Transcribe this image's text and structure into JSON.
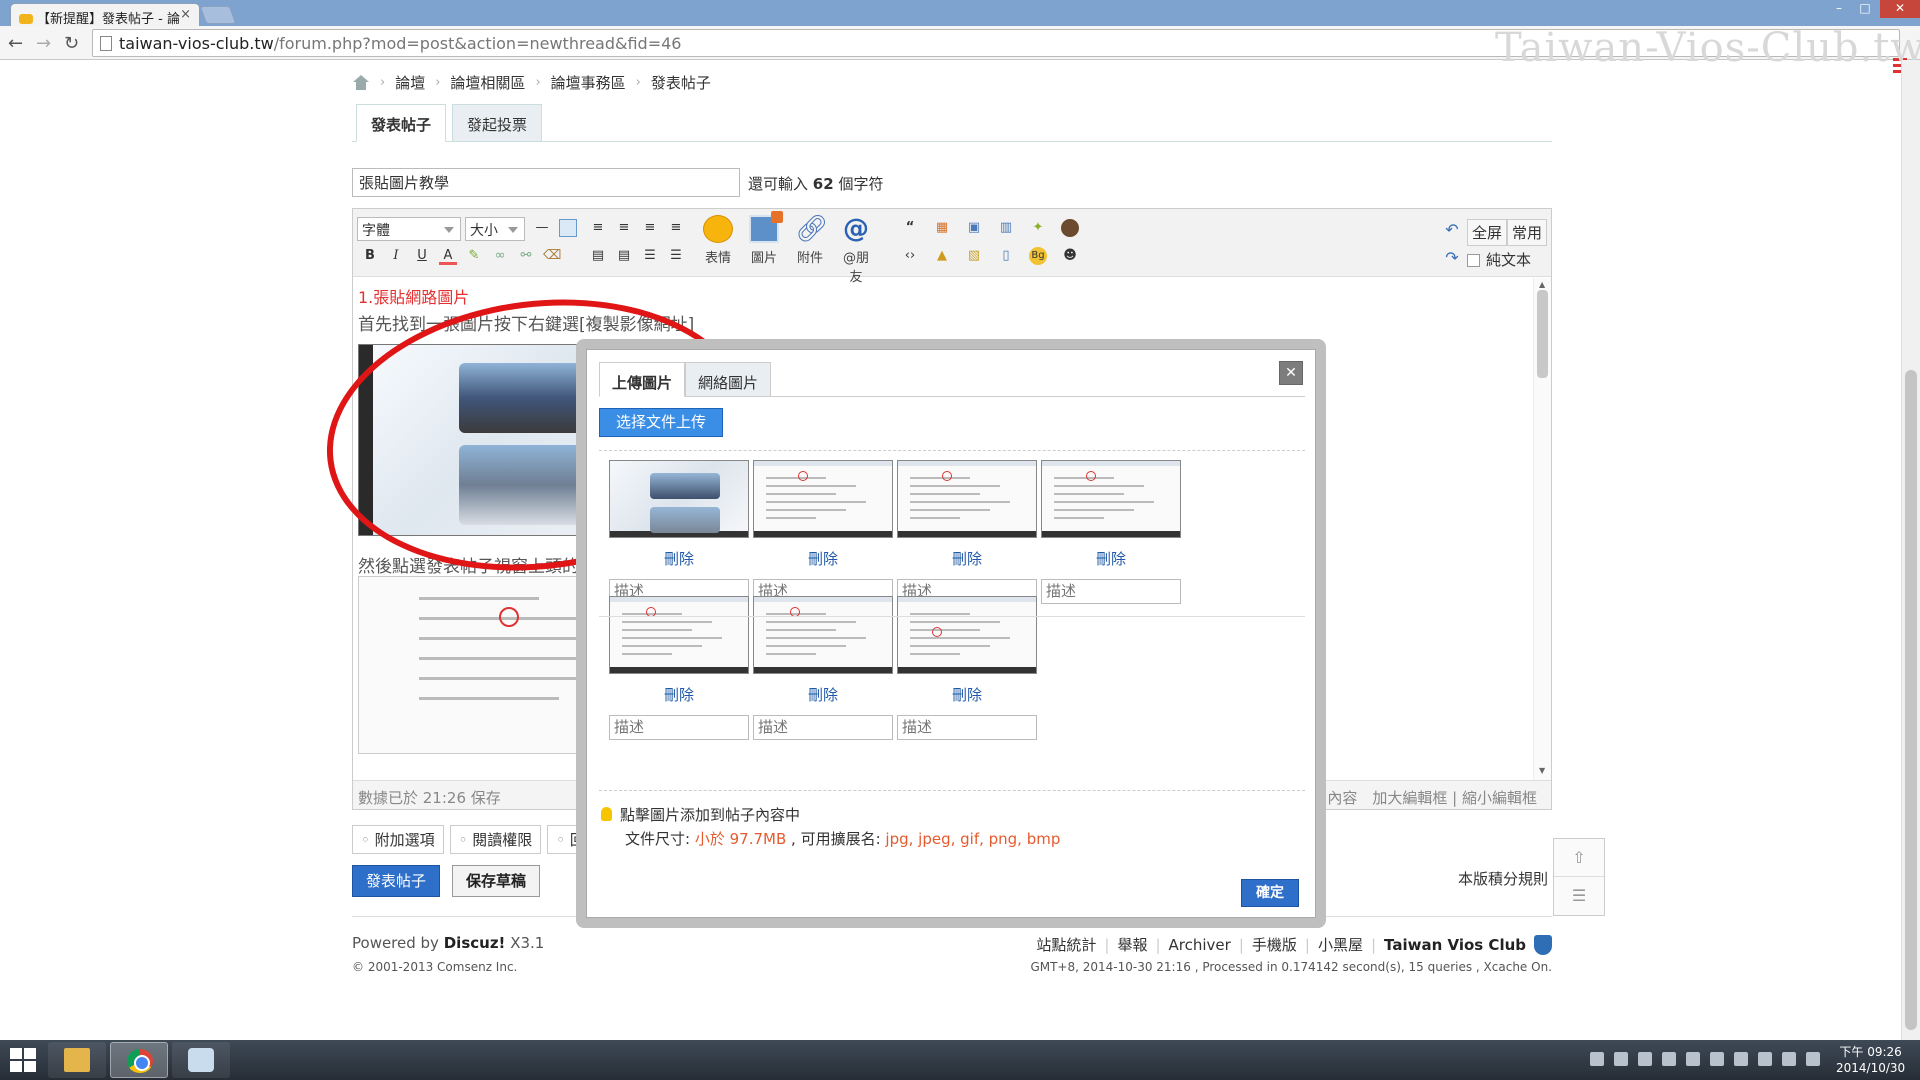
{
  "browser": {
    "tab_title": "【新提醒】發表帖子 - 論",
    "tab_close": "×",
    "url_host": "taiwan-vios-club.tw",
    "url_path": "/forum.php?mod=post&action=newthread&fid=46",
    "watermark": "Taiwan-Vios-Club.tw",
    "back": "←",
    "forward": "→",
    "reload": "↻",
    "win_min": "–",
    "win_max": "□",
    "win_close": "✕"
  },
  "breadcrumb": {
    "items": [
      "論壇",
      "論壇相關區",
      "論壇事務區",
      "發表帖子"
    ],
    "sep": "›"
  },
  "post_tabs": [
    "發表帖子",
    "發起投票"
  ],
  "subject": {
    "value": "張貼圖片教學",
    "hint_prefix": "還可輸入",
    "remaining": "62",
    "hint_suffix": "個字符"
  },
  "editor": {
    "font_select": "字體",
    "size_select": "大小",
    "format_icons": [
      "B",
      "I",
      "U",
      "A"
    ],
    "big_buttons": [
      "表情",
      "圖片",
      "附件",
      "@朋友"
    ],
    "right_buttons": {
      "fullscreen": "全屏",
      "common": "常用",
      "plaintext": "純文本"
    },
    "content": {
      "title": "1.張貼網路圖片",
      "line1": "首先找到一張圖片按下右鍵選[複製影像網址]",
      "line2": "然後點選發表帖子視窗上頭的"
    },
    "footer_left": "數據已於 21:26 保存",
    "footer_right": "內容　加大編輯框 | 縮小編輯框"
  },
  "options": [
    "附加選項",
    "閱讀權限",
    "回"
  ],
  "buttons": {
    "submit": "發表帖子",
    "draft": "保存草稿",
    "credit_rule": "本版積分規則"
  },
  "dialog": {
    "tabs": [
      "上傳圖片",
      "網絡圖片"
    ],
    "close": "✕",
    "choose_button": "选择文件上传",
    "thumbnails": [
      {
        "type": "car",
        "delete": "刪除",
        "desc": "描述"
      },
      {
        "type": "screen",
        "delete": "刪除",
        "desc": "描述"
      },
      {
        "type": "screen",
        "delete": "刪除",
        "desc": "描述"
      },
      {
        "type": "screen",
        "delete": "刪除",
        "desc": "描述"
      },
      {
        "type": "screen",
        "delete": "刪除",
        "desc": "描述"
      },
      {
        "type": "screen",
        "delete": "刪除",
        "desc": "描述"
      },
      {
        "type": "screen",
        "delete": "刪除",
        "desc": "描述"
      }
    ],
    "tip_line1": "點擊圖片添加到帖子內容中",
    "tip_size_label": "文件尺寸:",
    "tip_size_value": "小於 97.7MB",
    "tip_ext_label": ", 可用擴展名:",
    "tip_ext_value": "jpg, jpeg, gif, png, bmp",
    "ok": "確定"
  },
  "footer": {
    "powered_prefix": "Powered by",
    "powered_brand": "Discuz!",
    "powered_version": "X3.1",
    "copyright": "© 2001-2013 Comsenz Inc.",
    "links": [
      "站點統計",
      "舉報",
      "Archiver",
      "手機版",
      "小黑屋"
    ],
    "site_name": "Taiwan Vios Club",
    "gmt": "GMT+8, 2014-10-30 21:16 , Processed in 0.174142 second(s), 15 queries , Xcache On."
  },
  "taskbar": {
    "time": "下午 09:26",
    "date": "2014/10/30"
  },
  "colors": {
    "accent_blue": "#2d6fc9",
    "annotation_red": "#e01515",
    "link_blue": "#1f5aa6"
  }
}
